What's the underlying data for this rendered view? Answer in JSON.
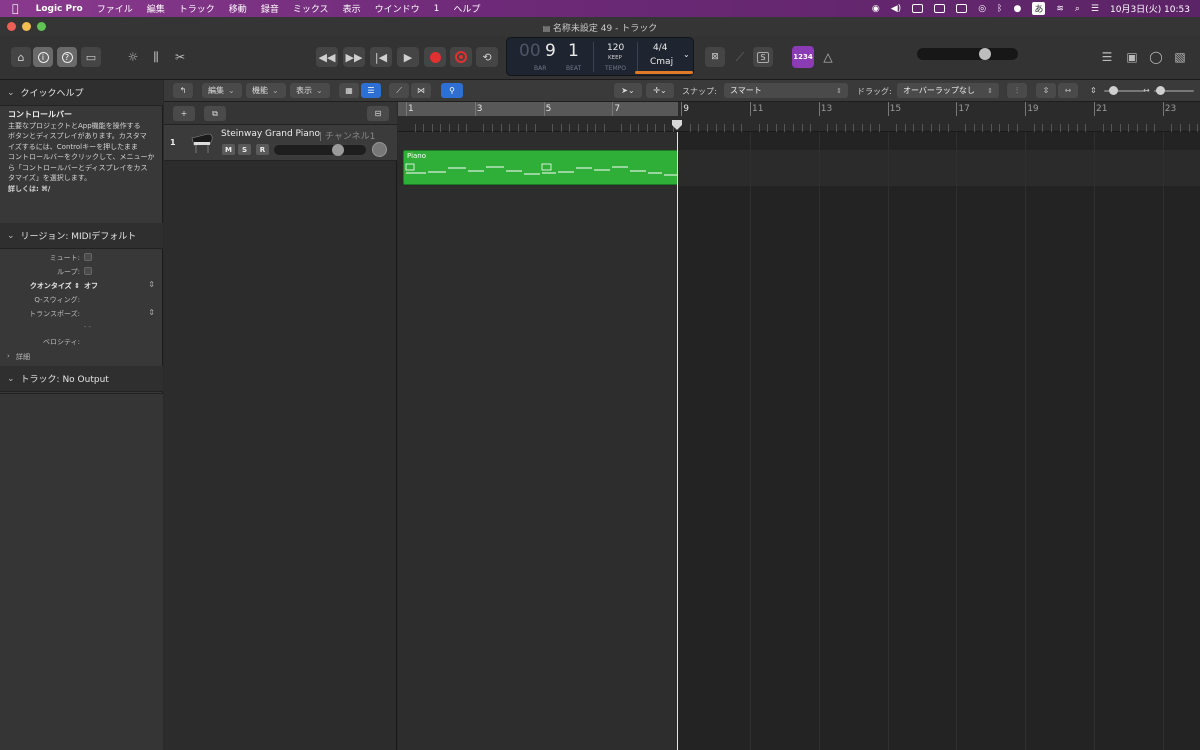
{
  "menubar": {
    "apple": "",
    "app": "Logic Pro",
    "items": [
      "ファイル",
      "編集",
      "トラック",
      "移動",
      "録音",
      "ミックス",
      "表示",
      "ウインドウ",
      "1",
      "ヘルプ"
    ],
    "ime": "あ",
    "clock": "10月3日(火)  10:53"
  },
  "window": {
    "title": "名称未設定 49 - トラック"
  },
  "lcd": {
    "bar_prefix": "00",
    "bar": "9",
    "beat": "1",
    "bar_label": "BAR",
    "beat_label": "BEAT",
    "tempo": "120",
    "keep": "KEEP",
    "tempo_label": "TEMPO",
    "signature": "4/4",
    "key": "Cmaj"
  },
  "controlbar": {
    "count_in": "1234"
  },
  "inspector": {
    "quickhelp_header": "クイックヘルプ",
    "quickhelp_title": "コントロールバー",
    "quickhelp_lines": [
      "主要なプロジェクトとApp機能を操作する",
      "ボタンとディスプレイがあります。カスタマ",
      "イズするには、Controlキーを押したまま",
      "コントロールバーをクリックして、メニューか",
      "ら「コントロールバーとディスプレイをカス",
      "タマイズ」を選択します。"
    ],
    "quickhelp_more": "詳しくは: ⌘/",
    "region_header": "リージョン: MIDIデフォルト",
    "region_rows": {
      "mute": "ミュート:",
      "loop": "ループ:",
      "quantize": "クオンタイズ",
      "quantize_value": "オフ",
      "qswing": "Q-スウィング:",
      "transpose": "トランスポーズ:",
      "dash": "- -",
      "velocity": "ベロシティ:",
      "detail": "詳細"
    },
    "track_header": "トラック:  No Output"
  },
  "track_toolbar": {
    "back": "↰",
    "edit": "編集",
    "function": "機能",
    "view": "表示",
    "snap_label": "スナップ:",
    "snap_value": "スマート",
    "drag_label": "ドラッグ:",
    "drag_value": "オーバーラップなし"
  },
  "track": {
    "number": "1",
    "name": "Steinway Grand Piano",
    "channel": "チャンネル1",
    "m": "M",
    "s": "S",
    "r": "R"
  },
  "ruler": {
    "bars": [
      "1",
      "3",
      "5",
      "7",
      "9",
      "11",
      "13",
      "15",
      "17",
      "19",
      "21",
      "23"
    ]
  },
  "region": {
    "name": "Piano"
  }
}
